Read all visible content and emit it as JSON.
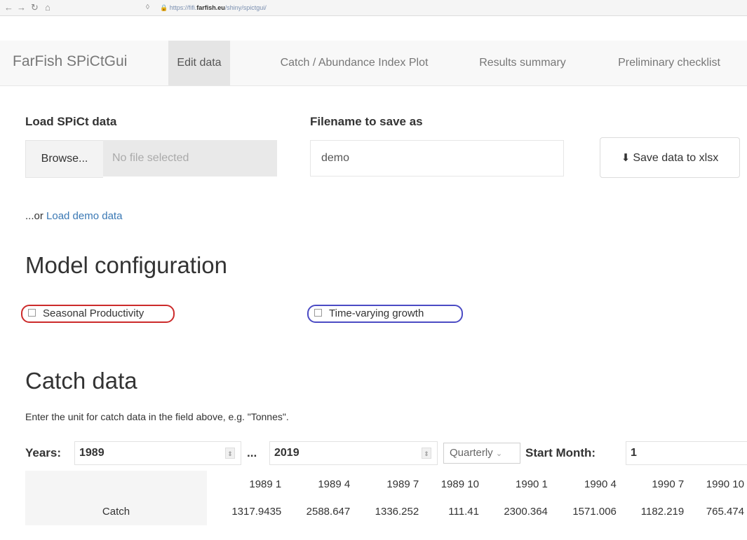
{
  "browser": {
    "url_prefix": "https://fifi.",
    "url_host": "farfish.eu",
    "url_suffix": "/shiny/spictgui/"
  },
  "navbar": {
    "app_title": "FarFish SPiCtGui",
    "tabs": [
      {
        "label": "Edit data",
        "active": true
      },
      {
        "label": "Catch / Abundance Index Plot",
        "active": false
      },
      {
        "label": "Results summary",
        "active": false
      },
      {
        "label": "Preliminary checklist",
        "active": false
      }
    ]
  },
  "load": {
    "heading": "Load SPiCt data",
    "browse_label": "Browse...",
    "file_status": "No file selected",
    "filename_heading": "Filename to save as",
    "filename_value": "demo",
    "save_label": "Save data to xlsx",
    "or_text": "...or ",
    "demo_link": "Load demo data"
  },
  "model_config": {
    "heading": "Model configuration",
    "seasonal_label": "Seasonal Productivity",
    "timevarying_label": "Time-varying growth",
    "colors": {
      "seasonal_border": "#cc2b2b",
      "timevarying_border": "#4b4bc4"
    }
  },
  "catch": {
    "heading": "Catch data",
    "description": "Enter the unit for catch data in the field above, e.g. \"Tonnes\".",
    "years_label": "Years:",
    "year_from": "1989",
    "dots": "...",
    "year_to": "2019",
    "frequency": "Quarterly",
    "start_month_label": "Start Month:",
    "start_month_value": "1",
    "table": {
      "row_label": "Catch",
      "headers": [
        "1989 1",
        "1989 4",
        "1989 7",
        "1989 10",
        "1990 1",
        "1990 4",
        "1990 7",
        "1990 10"
      ],
      "values": [
        "1317.9435",
        "2588.647",
        "1336.252",
        "111.41",
        "2300.364",
        "1571.006",
        "1182.219",
        "765.474"
      ]
    }
  }
}
